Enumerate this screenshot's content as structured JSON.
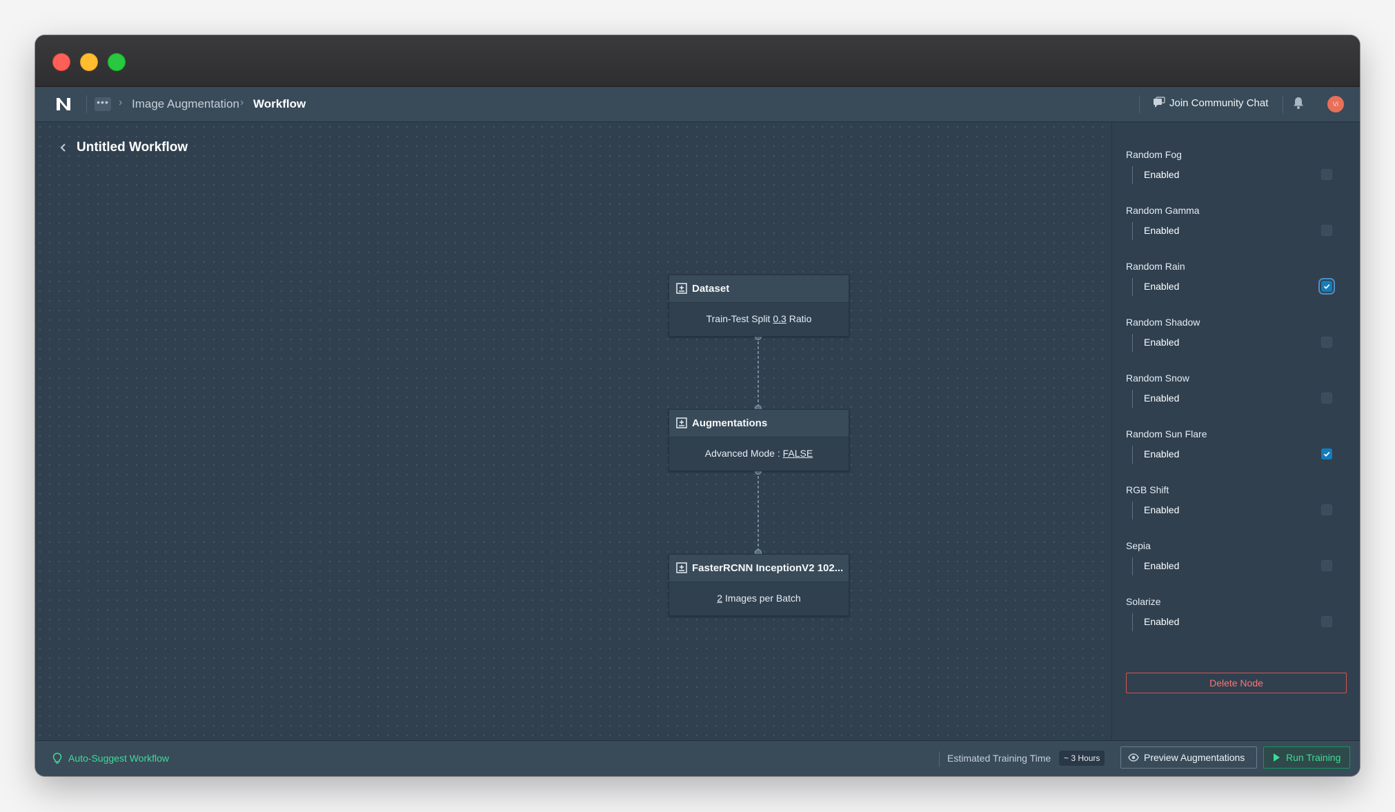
{
  "header": {
    "breadcrumbs": [
      "Image Augmentation",
      "Workflow"
    ],
    "community_label": "Join Community Chat",
    "avatar_initials": "VI"
  },
  "workflow": {
    "title": "Untitled Workflow",
    "nodes": [
      {
        "title": "Dataset",
        "pre": "Train-Test Split ",
        "value": "0.3",
        "post": " Ratio"
      },
      {
        "title": "Augmentations",
        "pre": "Advanced Mode : ",
        "value": "FALSE",
        "post": ""
      },
      {
        "title": "FasterRCNN InceptionV2 102...",
        "pre": "",
        "value": "2",
        "post": " Images per Batch"
      }
    ]
  },
  "panel": {
    "augmentations": [
      {
        "name": "Random Fog",
        "option": "Enabled",
        "checked": false
      },
      {
        "name": "Random Gamma",
        "option": "Enabled",
        "checked": false
      },
      {
        "name": "Random Rain",
        "option": "Enabled",
        "checked": true
      },
      {
        "name": "Random Shadow",
        "option": "Enabled",
        "checked": false
      },
      {
        "name": "Random Snow",
        "option": "Enabled",
        "checked": false
      },
      {
        "name": "Random Sun Flare",
        "option": "Enabled",
        "checked": true
      },
      {
        "name": "RGB Shift",
        "option": "Enabled",
        "checked": false
      },
      {
        "name": "Sepia",
        "option": "Enabled",
        "checked": false
      },
      {
        "name": "Solarize",
        "option": "Enabled",
        "checked": false
      }
    ],
    "delete_label": "Delete Node"
  },
  "footer": {
    "autosuggest_label": "Auto-Suggest Workflow",
    "estimate_label": "Estimated Training Time",
    "estimate_value": "~ 3 Hours",
    "preview_label": "Preview Augmentations",
    "run_label": "Run Training"
  },
  "colors": {
    "accent_green": "#3ddc97",
    "danger": "#ff7373",
    "checkbox_checked": "#137cbd"
  }
}
